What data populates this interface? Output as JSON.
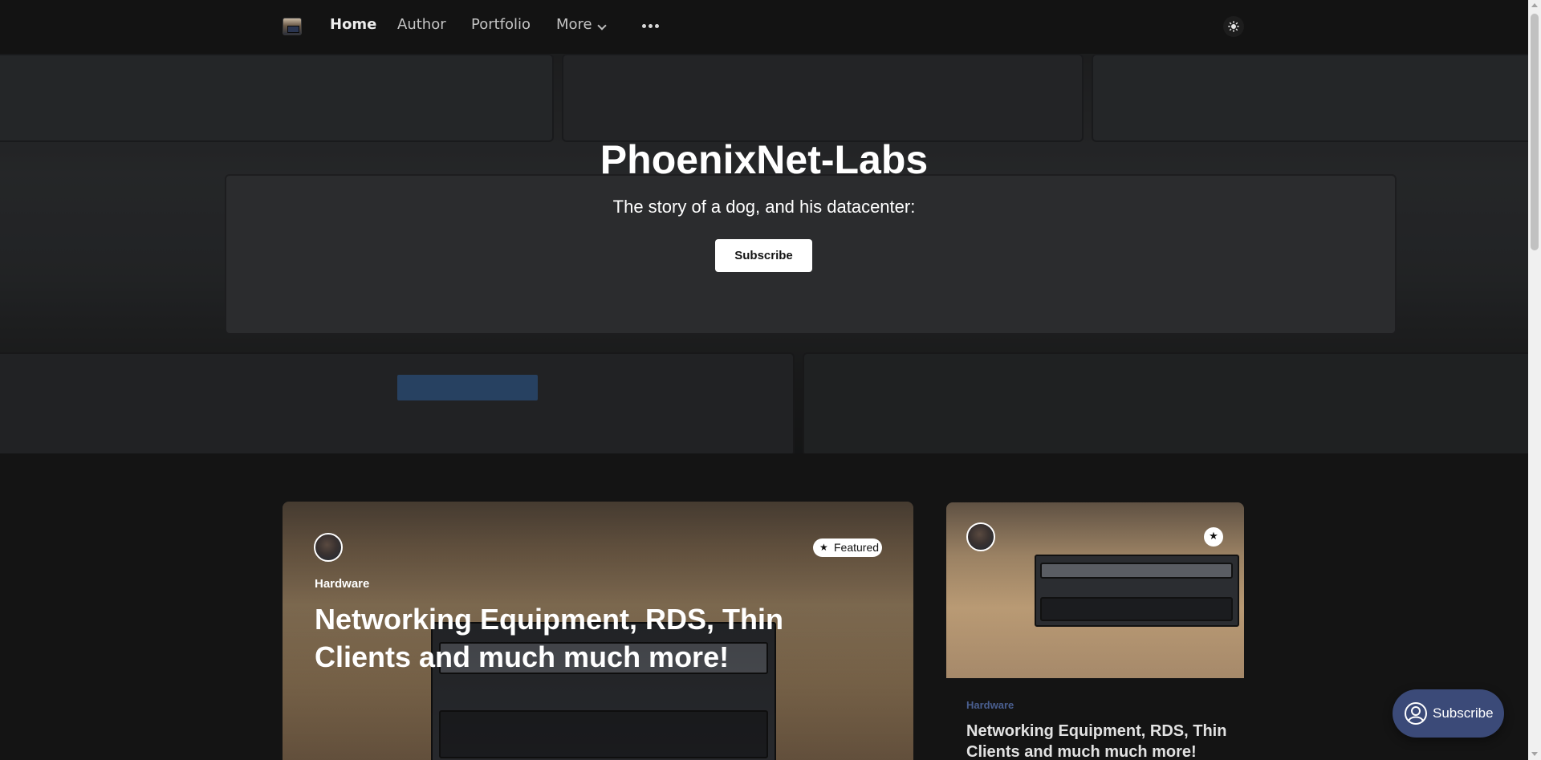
{
  "nav": {
    "items": [
      {
        "label": "Home",
        "active": true
      },
      {
        "label": "Author"
      },
      {
        "label": "Portfolio"
      },
      {
        "label": "More"
      }
    ],
    "more_icon": "chevron-down-icon",
    "menu_icon": "ellipsis-icon",
    "theme_icon": "sun-icon"
  },
  "hero": {
    "title": "PhoenixNet-Labs",
    "description": "The story of a dog, and his datacenter:",
    "subscribe_label": "Subscribe"
  },
  "featured_post": {
    "badge": "Featured",
    "tag": "Hardware",
    "title": "Networking Equipment, RDS, Thin Clients and much much more!"
  },
  "side_post": {
    "tag": "Hardware",
    "title": "Networking Equipment, RDS, Thin Clients and much much more!"
  },
  "portal": {
    "label": "Subscribe"
  },
  "colors": {
    "nav_bg": "#131313",
    "page_bg": "#141414",
    "accent": "#3b4a78",
    "tag_accent": "#4a5f90"
  }
}
